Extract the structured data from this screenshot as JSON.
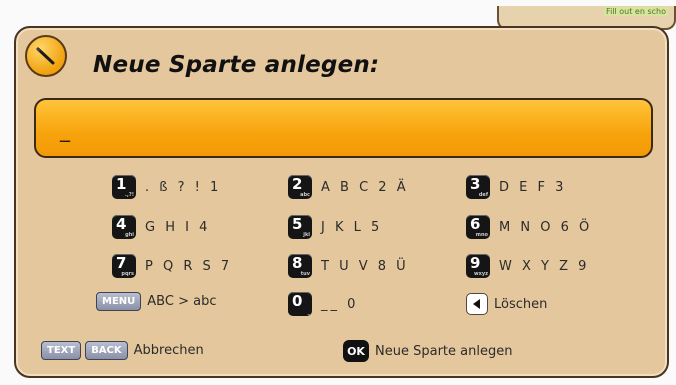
{
  "dialog": {
    "title": "Neue Sparte anlegen:",
    "input_value": "_"
  },
  "corner_hint": "Fill out en scho",
  "keypad": [
    {
      "digit": "1",
      "sub": ".,?!",
      "chars": ". ß ? ! 1"
    },
    {
      "digit": "2",
      "sub": "abc",
      "chars": "A B C 2 Ä"
    },
    {
      "digit": "3",
      "sub": "def",
      "chars": "D E F 3"
    },
    {
      "digit": "4",
      "sub": "ghi",
      "chars": "G H I 4"
    },
    {
      "digit": "5",
      "sub": "jkl",
      "chars": "J K L 5"
    },
    {
      "digit": "6",
      "sub": "mno",
      "chars": "M N O 6 Ö"
    },
    {
      "digit": "7",
      "sub": "pqrs",
      "chars": "P Q R S 7"
    },
    {
      "digit": "8",
      "sub": "tuv",
      "chars": "T U V 8 Ü"
    },
    {
      "digit": "9",
      "sub": "wxyz",
      "chars": "W X Y Z 9"
    },
    {
      "digit": "0",
      "sub": "_",
      "chars": "__ 0"
    }
  ],
  "menu": {
    "key": "MENU",
    "label": "ABC > abc"
  },
  "delete": {
    "label": "Löschen"
  },
  "cancel": {
    "key1": "TEXT",
    "key2": "BACK",
    "label": "Abbrechen"
  },
  "confirm": {
    "key": "OK",
    "label": "Neue Sparte anlegen"
  },
  "icons": {
    "title_icon": "pencil-icon",
    "delete_icon": "backspace-icon"
  },
  "colors": {
    "frame": "#e4c79c",
    "input": "#f7a30c",
    "border": "#4a3521"
  }
}
